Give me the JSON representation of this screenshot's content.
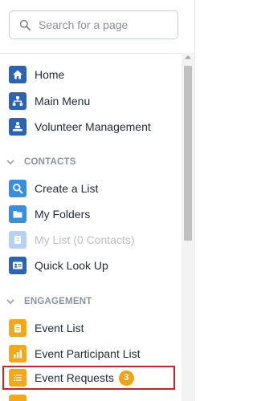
{
  "search": {
    "placeholder": "Search for a page"
  },
  "top_items": [
    {
      "label": "Home",
      "icon": "home-icon"
    },
    {
      "label": "Main Menu",
      "icon": "sitemap-icon"
    },
    {
      "label": "Volunteer Management",
      "icon": "volunteer-icon"
    }
  ],
  "sections": {
    "contacts": {
      "title": "CONTACTS",
      "items": [
        {
          "label": "Create a List",
          "icon": "search-icon"
        },
        {
          "label": "My Folders",
          "icon": "folder-icon"
        },
        {
          "label": "My List (0 Contacts)",
          "icon": "list-document-icon",
          "disabled": true
        },
        {
          "label": "Quick Look Up",
          "icon": "contact-card-icon"
        }
      ]
    },
    "engagement": {
      "title": "ENGAGEMENT",
      "items": [
        {
          "label": "Event List",
          "icon": "clipboard-icon"
        },
        {
          "label": "Event Participant List",
          "icon": "bar-chart-icon"
        },
        {
          "label": "Event Requests",
          "icon": "list-icon",
          "badge": "3",
          "highlighted": true
        }
      ]
    }
  },
  "colors": {
    "nav_blue": "#2d63b3",
    "action_blue": "#3a8ee0",
    "engagement_orange": "#f3a71b",
    "highlight_red": "#d5202b",
    "badge_orange": "#f0a318"
  }
}
